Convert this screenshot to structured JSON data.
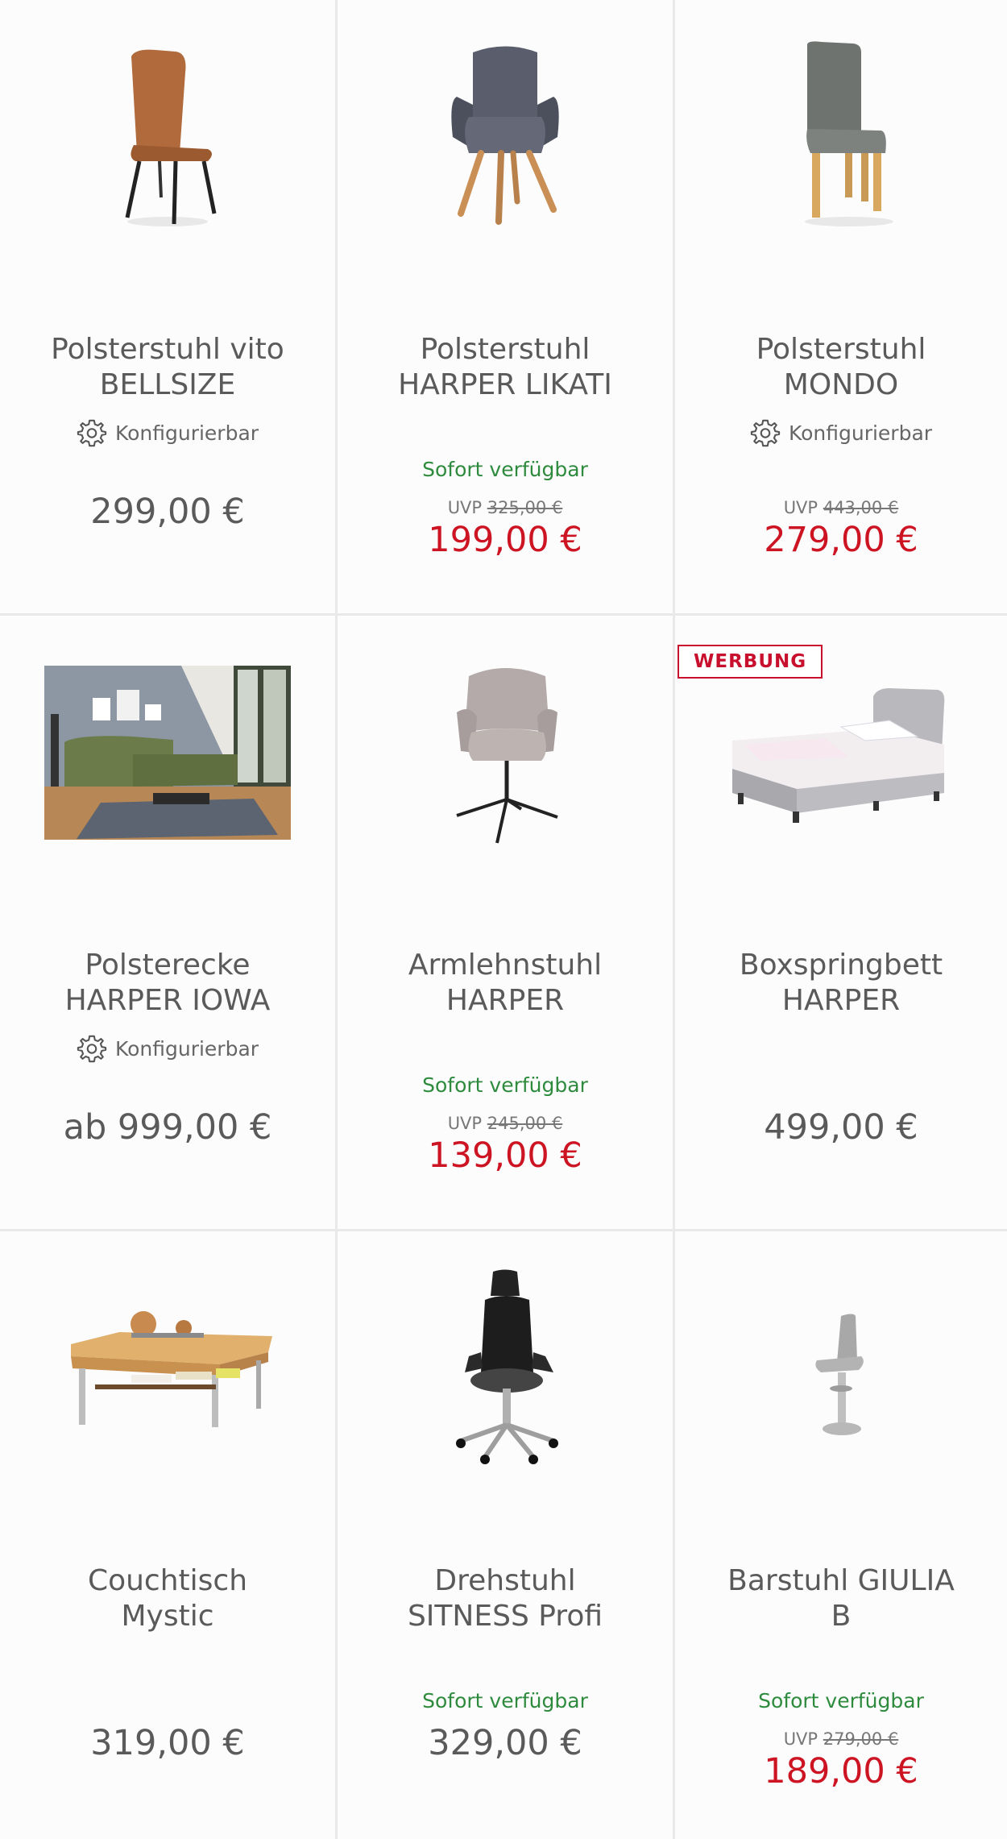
{
  "colors": {
    "sale_red": "#cc1423",
    "available_green": "#2e8b3e",
    "badge_red": "#c8102e",
    "divider": "#e9e9e9"
  },
  "labels": {
    "configurable": "Konfigurierbar",
    "available": "Sofort verfügbar",
    "uvp": "UVP",
    "ad": "WERBUNG"
  },
  "products": [
    {
      "name": "Polsterstuhl vito\nBELLSIZE",
      "configurable": true,
      "price": "299,00 €",
      "image": "brown-dining-chair"
    },
    {
      "name": "Polsterstuhl\nHARPER LIKATI",
      "available": true,
      "uvp": "325,00 €",
      "sale_price": "199,00 €",
      "image": "gray-armchair-wood-legs"
    },
    {
      "name": "Polsterstuhl\nMONDO",
      "configurable": true,
      "uvp": "443,00 €",
      "sale_price": "279,00 €",
      "image": "gray-high-back-chair"
    },
    {
      "name": "Polsterecke\nHARPER IOWA",
      "configurable": true,
      "price": "ab 999,00 €",
      "image": "green-corner-sofa-room"
    },
    {
      "name": "Armlehnstuhl\nHARPER",
      "available": true,
      "uvp": "245,00 €",
      "sale_price": "139,00 €",
      "image": "pink-swivel-armchair"
    },
    {
      "name": "Boxspringbett\nHARPER",
      "ad": true,
      "price": "499,00 €",
      "image": "gray-boxspring-bed"
    },
    {
      "name": "Couchtisch\nMystic",
      "price": "319,00 €",
      "image": "wooden-coffee-table"
    },
    {
      "name": "Drehstuhl\nSITNESS Profi",
      "available": true,
      "price": "329,00 €",
      "image": "black-office-chair"
    },
    {
      "name": "Barstuhl GIULIA\nB",
      "available": true,
      "uvp": "279,00 €",
      "sale_price": "189,00 €",
      "image": "gray-bar-stool"
    }
  ]
}
